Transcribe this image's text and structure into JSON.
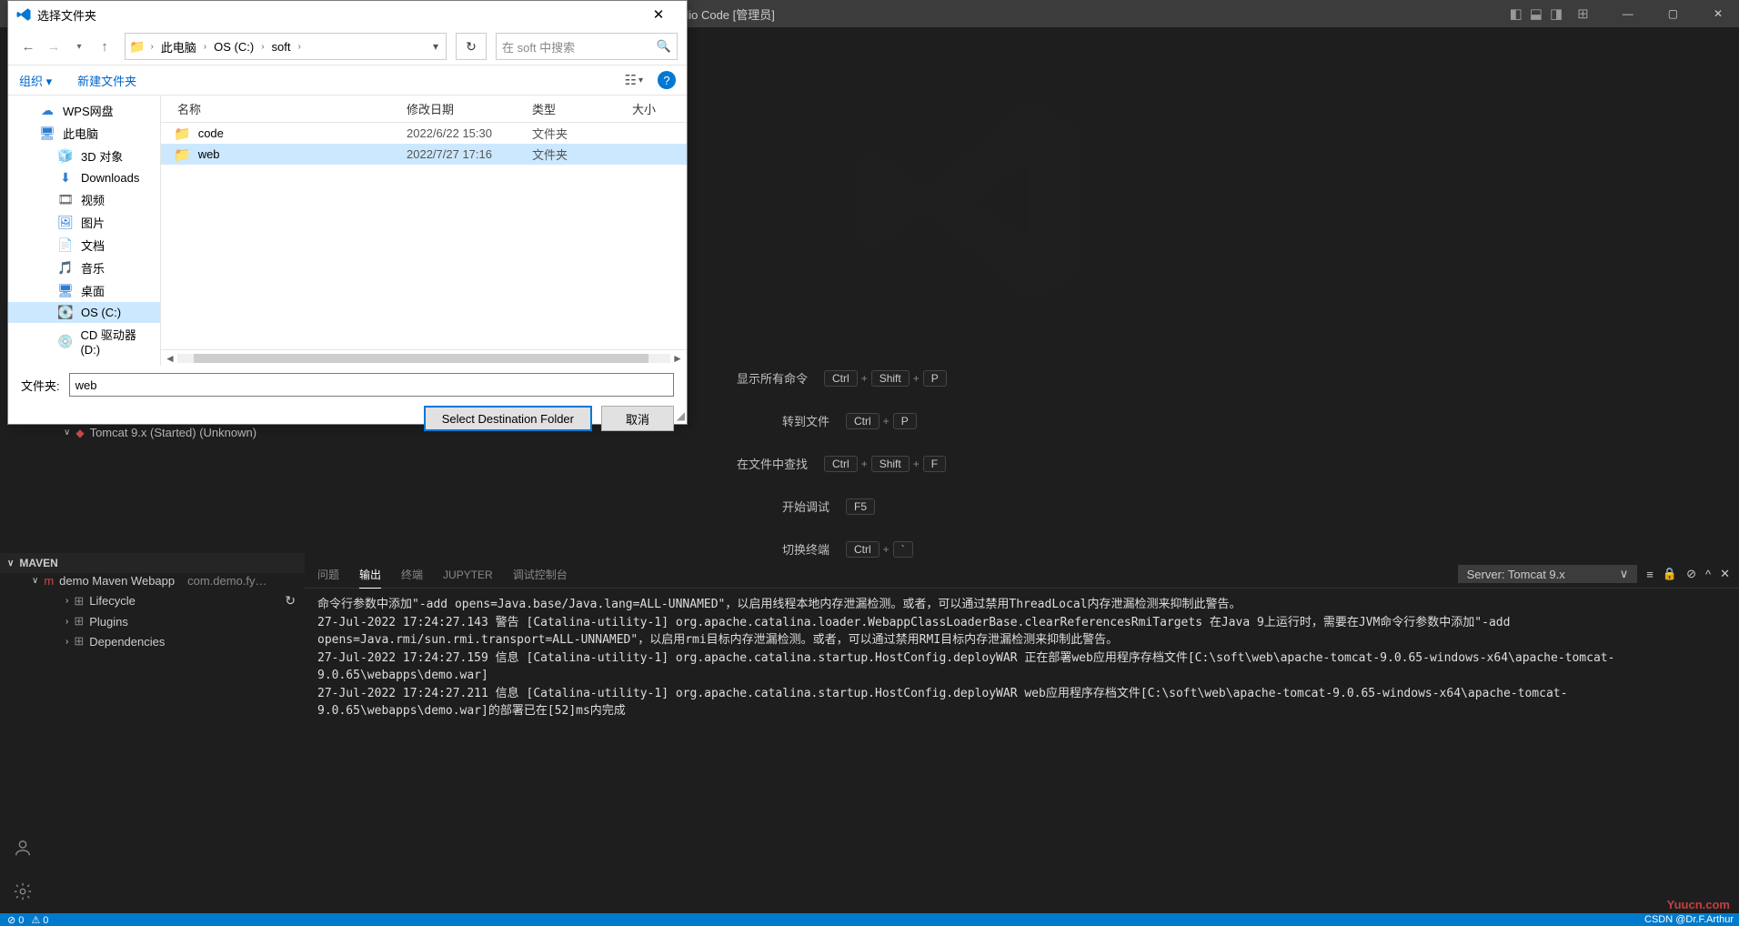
{
  "vscode": {
    "title": "dio Code [管理员]",
    "shortcuts": [
      {
        "label": "显示所有命令",
        "keys": [
          "Ctrl",
          "Shift",
          "P"
        ]
      },
      {
        "label": "转到文件",
        "keys": [
          "Ctrl",
          "P"
        ]
      },
      {
        "label": "在文件中查找",
        "keys": [
          "Ctrl",
          "Shift",
          "F"
        ]
      },
      {
        "label": "开始调试",
        "keys": [
          "F5"
        ]
      },
      {
        "label": "切换终端",
        "keys": [
          "Ctrl",
          "`"
        ]
      }
    ],
    "tomcat": "Tomcat 9.x (Started) (Unknown)",
    "maven": {
      "header": "MAVEN",
      "project": "demo Maven Webapp",
      "project_desc": "com.demo.fy…",
      "items": [
        "Lifecycle",
        "Plugins",
        "Dependencies"
      ]
    },
    "terminal": {
      "tabs": [
        "问题",
        "输出",
        "终端",
        "JUPYTER",
        "调试控制台"
      ],
      "active_tab": "输出",
      "server_label": "Server: Tomcat 9.x",
      "lines": [
        "命令行参数中添加\"-add opens=Java.base/Java.lang=ALL-UNNAMED\"，以启用线程本地内存泄漏检测。或者，可以通过禁用ThreadLocal内存泄漏检测来抑制此警告。",
        "27-Jul-2022 17:24:27.143 警告 [Catalina-utility-1] org.apache.catalina.loader.WebappClassLoaderBase.clearReferencesRmiTargets 在Java 9上运行时，需要在JVM命令行参数中添加\"-add opens=Java.rmi/sun.rmi.transport=ALL-UNNAMED\"，以启用rmi目标内存泄漏检测。或者，可以通过禁用RMI目标内存泄漏检测来抑制此警告。",
        "27-Jul-2022 17:24:27.159 信息 [Catalina-utility-1] org.apache.catalina.startup.HostConfig.deployWAR 正在部署web应用程序存档文件[C:\\soft\\web\\apache-tomcat-9.0.65-windows-x64\\apache-tomcat-9.0.65\\webapps\\demo.war]",
        "27-Jul-2022 17:24:27.211 信息 [Catalina-utility-1] org.apache.catalina.startup.HostConfig.deployWAR web应用程序存档文件[C:\\soft\\web\\apache-tomcat-9.0.65-windows-x64\\apache-tomcat-9.0.65\\webapps\\demo.war]的部署已在[52]ms内完成"
      ]
    },
    "statusbar": {
      "errors": "⊘ 0",
      "warnings": "⚠ 0"
    },
    "csdn": "CSDN @Dr.F.Arthur",
    "watermark": "Yuucn.com"
  },
  "dialog": {
    "title": "选择文件夹",
    "breadcrumbs": [
      "此电脑",
      "OS (C:)",
      "soft"
    ],
    "search_placeholder": "在 soft 中搜索",
    "toolbar": {
      "organize": "组织 ▾",
      "new_folder": "新建文件夹"
    },
    "tree": [
      {
        "icon": "☁",
        "label": "WPS网盘",
        "color": "#2d7dd2",
        "level": 1
      },
      {
        "icon": "🖥",
        "label": "此电脑",
        "color": "#2d7dd2",
        "level": 1
      },
      {
        "icon": "🧊",
        "label": "3D 对象",
        "color": "#2d7dd2",
        "level": 2
      },
      {
        "icon": "⬇",
        "label": "Downloads",
        "color": "#2d7dd2",
        "level": 2
      },
      {
        "icon": "🎞",
        "label": "视频",
        "color": "#555",
        "level": 2
      },
      {
        "icon": "🖼",
        "label": "图片",
        "color": "#2d7dd2",
        "level": 2
      },
      {
        "icon": "📄",
        "label": "文档",
        "color": "#2d7dd2",
        "level": 2
      },
      {
        "icon": "🎵",
        "label": "音乐",
        "color": "#2d7dd2",
        "level": 2
      },
      {
        "icon": "🖥",
        "label": "桌面",
        "color": "#2d7dd2",
        "level": 2
      },
      {
        "icon": "💽",
        "label": "OS (C:)",
        "color": "#555",
        "level": 2,
        "selected": true
      },
      {
        "icon": "💿",
        "label": "CD 驱动器 (D:)",
        "color": "#888",
        "level": 2
      }
    ],
    "columns": {
      "name": "名称",
      "date": "修改日期",
      "type": "类型",
      "size": "大小"
    },
    "rows": [
      {
        "name": "code",
        "date": "2022/6/22 15:30",
        "type": "文件夹",
        "selected": false
      },
      {
        "name": "web",
        "date": "2022/7/27 17:16",
        "type": "文件夹",
        "selected": true
      }
    ],
    "folder_label": "文件夹:",
    "folder_value": "web",
    "buttons": {
      "primary": "Select Destination Folder",
      "cancel": "取消"
    }
  }
}
